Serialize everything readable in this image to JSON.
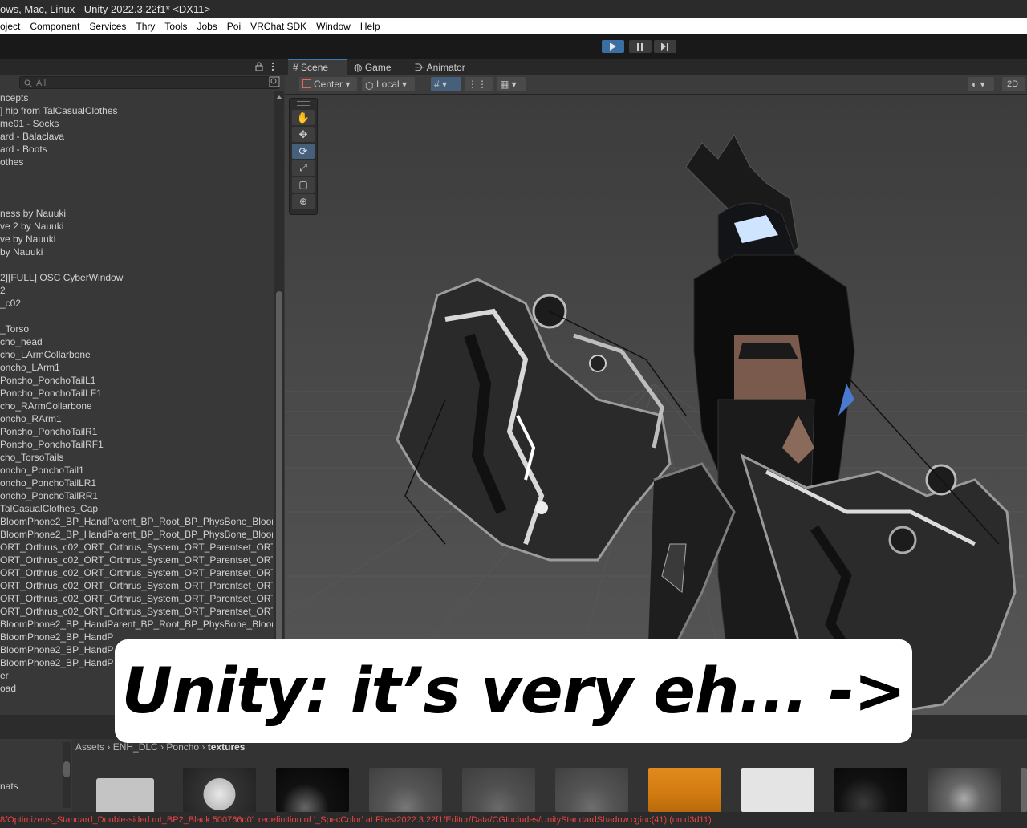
{
  "window": {
    "title": "ows, Mac, Linux - Unity 2022.3.22f1* <DX11>"
  },
  "menu": [
    "oject",
    "Component",
    "Services",
    "Thry",
    "Tools",
    "Jobs",
    "Poi",
    "VRChat SDK",
    "Window",
    "Help"
  ],
  "hierarchy": {
    "search_placeholder": "All",
    "rows": [
      "ncepts",
      "] hip from TalCasualClothes",
      "me01 - Socks",
      "ard - Balaclava",
      "ard - Boots",
      "othes",
      "",
      "",
      "",
      "ness by Nauuki",
      "ve 2 by Nauuki",
      "ve by Nauuki",
      "by Nauuki",
      "",
      "2][FULL] OSC CyberWindow",
      "2",
      "_c02",
      "",
      "_Torso",
      "cho_head",
      "cho_LArmCollarbone",
      "oncho_LArm1",
      "Poncho_PonchoTailL1",
      "Poncho_PonchoTailLF1",
      "cho_RArmCollarbone",
      "oncho_RArm1",
      "Poncho_PonchoTailR1",
      "Poncho_PonchoTailRF1",
      "cho_TorsoTails",
      "oncho_PonchoTail1",
      "oncho_PonchoTailLR1",
      "oncho_PonchoTailRR1",
      "TalCasualClothes_Cap",
      "BloomPhone2_BP_HandParent_BP_Root_BP_PhysBone_Bloom",
      "BloomPhone2_BP_HandParent_BP_Root_BP_PhysBone_Bloom",
      "ORT_Orthrus_c02_ORT_Orthrus_System_ORT_Parentset_ORT.",
      "ORT_Orthrus_c02_ORT_Orthrus_System_ORT_Parentset_ORT.",
      "ORT_Orthrus_c02_ORT_Orthrus_System_ORT_Parentset_ORT.",
      "ORT_Orthrus_c02_ORT_Orthrus_System_ORT_Parentset_ORT.",
      "ORT_Orthrus_c02_ORT_Orthrus_System_ORT_Parentset_ORT.",
      "ORT_Orthrus_c02_ORT_Orthrus_System_ORT_Parentset_ORT.",
      "BloomPhone2_BP_HandParent_BP_Root_BP_PhysBone_Bloom",
      "BloomPhone2_BP_HandP",
      "BloomPhone2_BP_HandP",
      "BloomPhone2_BP_HandP",
      "er",
      "oad"
    ]
  },
  "scene": {
    "tabs": [
      "Scene",
      "Game",
      "Animator"
    ],
    "pivot": "Center",
    "space": "Local",
    "mode_2d": "2D"
  },
  "project": {
    "breadcrumb": [
      "Assets",
      "ENH_DLC",
      "Poncho",
      "textures"
    ],
    "left_label": "nats"
  },
  "console": {
    "message": "8/Optimizer/s_Standard_Double-sided.mt_BP2_Black 500766d0': redefinition of '_SpecColor' at Files/2022.3.22f1/Editor/Data/CGIncludes/UnityStandardShadow.cginc(41) (on d3d11)"
  },
  "caption": {
    "text": "Unity: it’s very eh... ->"
  },
  "colors": {
    "accent": "#46607c",
    "error": "#ee4444",
    "play_active": "#3b6ea5"
  }
}
